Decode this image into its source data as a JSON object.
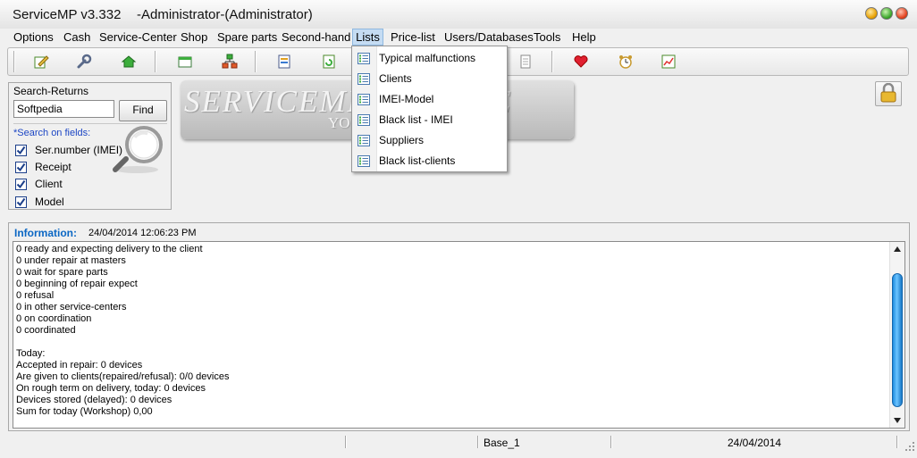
{
  "window": {
    "app_title": "ServiceMP v3.332",
    "user_title": "-Administrator-(Administrator)"
  },
  "menu": [
    "Options",
    "Cash",
    "Service-Center",
    "Shop",
    "Spare parts",
    "Second-hand",
    "Lists",
    "Price-list",
    "Users/Databases",
    "Tools",
    "Help"
  ],
  "toolbar_icons": [
    "edit-icon",
    "wrench-icon",
    "home-icon",
    "calendar-icon",
    "network-icon",
    "form-icon",
    "refresh-icon",
    "doc-icon",
    "page-icon",
    "heart-icon",
    "alarm-icon",
    "chart-icon"
  ],
  "lists_menu": {
    "items": [
      "Typical malfunctions",
      "Clients",
      "IMEI-Model",
      "Black list - IMEI",
      "Suppliers",
      "Black list-clients"
    ]
  },
  "search": {
    "title": "Search-Returns",
    "value": "Softpedia",
    "find_label": "Find",
    "fields_label": "*Search on fields:",
    "fields": [
      "Ser.number (IMEI)",
      "Receipt",
      "Client",
      "Model"
    ]
  },
  "banner": {
    "line1": "SERVICEMP          SERVICE",
    "line2": "YO"
  },
  "info": {
    "label": "Information:",
    "timestamp": "24/04/2014 12:06:23 PM",
    "lines": [
      "0 ready and expecting delivery to the client",
      "0 under repair at masters",
      "0 wait for spare parts",
      "0 beginning of repair expect",
      "0 refusal",
      "0 in other service-centers",
      "0 on coordination",
      "0 coordinated",
      "",
      "Today:",
      "Accepted in repair: 0 devices",
      "Are given to clients(repaired/refusal): 0/0 devices",
      "On rough term on delivery, today: 0 devices",
      "Devices stored (delayed): 0 devices",
      "Sum for today (Workshop) 0,00"
    ]
  },
  "status": {
    "base": "Base_1",
    "date": "24/04/2014"
  },
  "colors": {
    "accent": "#0b67c4",
    "menu_highlight": "#c5dcf3",
    "scroll_thumb": "#1d8ce0"
  }
}
